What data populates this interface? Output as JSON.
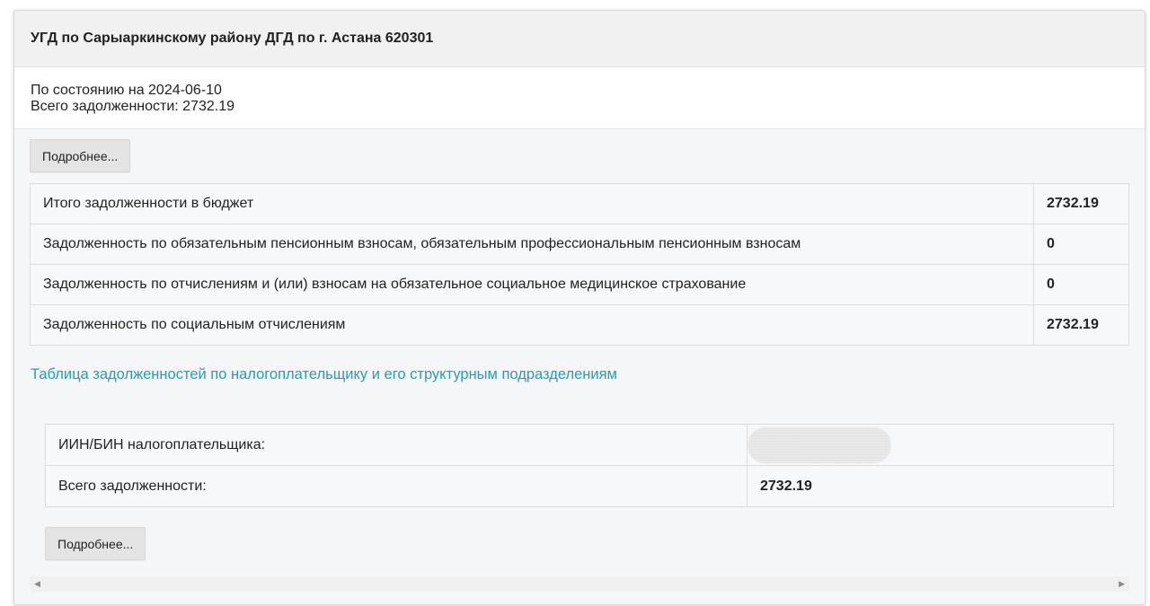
{
  "header": {
    "title": "УГД по Сарыаркинскому району ДГД по г. Астана 620301"
  },
  "info": {
    "status_date_line": "По состоянию на 2024-06-10",
    "total_debt_line": "Всего задолженности: 2732.19"
  },
  "details_button_top": "Подробнее...",
  "summary_table": {
    "rows": [
      {
        "label": "Итого задолженности в бюджет",
        "value": "2732.19"
      },
      {
        "label": "Задолженность по обязательным пенсионным взносам, обязательным профессиональным пенсионным взносам",
        "value": "0"
      },
      {
        "label": "Задолженность по отчислениям и (или) взносам на обязательное социальное медицинское страхование",
        "value": "0"
      },
      {
        "label": "Задолженность по социальным отчислениям",
        "value": "2732.19"
      }
    ]
  },
  "structural_link": "Таблица задолженностей по налогоплательщику и его структурным подразделениям",
  "taxpayer_table": {
    "iin_label": "ИИН/БИН налогоплательщика:",
    "total_label": "Всего задолженности:",
    "total_value": "2732.19"
  },
  "details_button_bottom": "Подробнее...",
  "scrollbar": {
    "left_arrow_icon": "◀",
    "right_arrow_icon": "▶"
  },
  "colors": {
    "link": "#2a9bb0",
    "header_bg": "#f1f1f1",
    "body_bg": "#f5f6f7"
  }
}
